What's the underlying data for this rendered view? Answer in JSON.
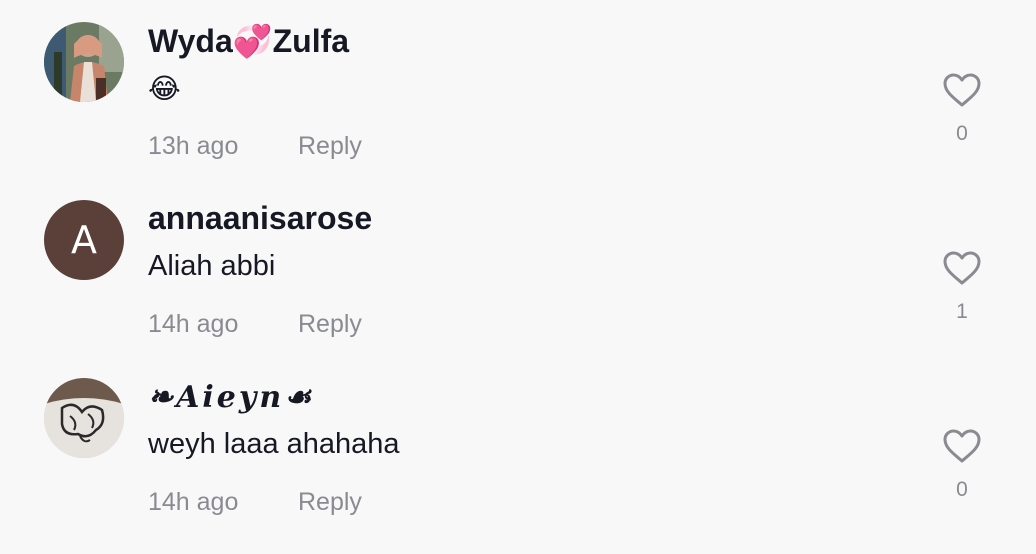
{
  "comments": [
    {
      "username": "Wyda💞Zulfa",
      "text": "😂",
      "time": "13h ago",
      "reply_label": "Reply",
      "likes": "0",
      "avatar_type": "photo"
    },
    {
      "username": "annaanisarose",
      "text": "Aliah abbi",
      "time": "14h ago",
      "reply_label": "Reply",
      "likes": "1",
      "avatar_type": "letter",
      "avatar_letter": "A",
      "avatar_color": "#5a4038"
    },
    {
      "username": "❧𝑨𝒊𝒆𝒚𝒏☙",
      "text": "weyh laaa ahahaha",
      "time": "14h ago",
      "reply_label": "Reply",
      "likes": "0",
      "avatar_type": "photo"
    }
  ],
  "icons": {
    "like": "heart-outline-icon"
  },
  "colors": {
    "text": "#161823",
    "muted": "#8a8b91",
    "background": "#f8f8f8"
  }
}
